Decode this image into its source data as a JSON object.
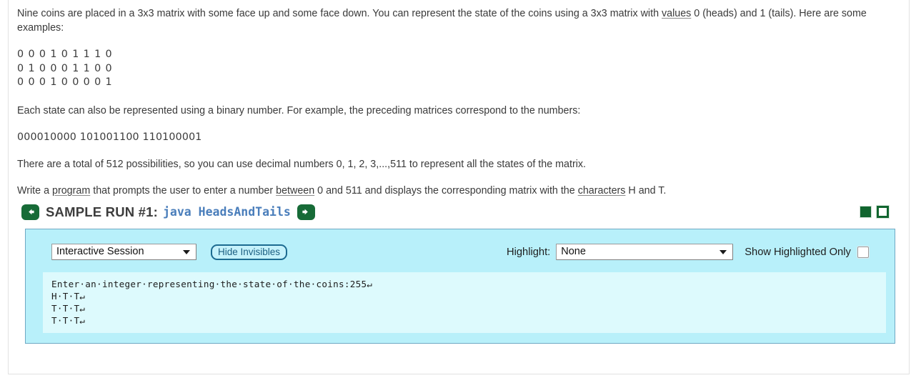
{
  "document": {
    "paragraphs": [
      "Nine coins are placed in a 3x3 matrix with some face up and some face down. You can represent the state of the coins using a 3x3 matrix with ",
      " 0 (heads) and 1 (tails). Here are some examples:"
    ],
    "p1_underlined_word": "values",
    "matrix_rows": [
      "0 0 0 1 0 1 1 1 0",
      "0 1 0 0 0 1 1 0 0",
      "0 0 0 1 0 0 0 0 1"
    ],
    "p2": "Each state can also be represented using a binary number. For example, the preceding matrices correspond to the numbers:",
    "binary_line": "000010000 101001100 110100001",
    "p3": "There are a total of 512 possibilities, so you can use decimal numbers 0, 1, 2, 3,...,511 to represent all the states of the matrix.",
    "p4_parts": {
      "a": "Write a ",
      "u1": "program",
      "b": " that prompts the user to enter a number ",
      "u2": "between",
      "c": " 0 and 511 and displays the corresponding matrix with the ",
      "u3": "characters",
      "d": " H and T."
    }
  },
  "sample_run": {
    "prev_icon": "arrow-left-icon",
    "next_icon": "arrow-right-icon",
    "title": "SAMPLE RUN #1:",
    "command": "java HeadsAndTails",
    "indicator_filled": "filled-square-indicator",
    "indicator_open": "open-square-indicator"
  },
  "panel": {
    "session_select": {
      "value": "Interactive Session",
      "options": [
        "Interactive Session"
      ]
    },
    "hide_invisibles_label": "Hide Invisibles",
    "highlight_label": "Highlight:",
    "highlight_select": {
      "value": "None",
      "options": [
        "None"
      ]
    },
    "show_highlighted_only_label": "Show Highlighted Only",
    "show_highlighted_only_checked": false,
    "terminal_lines": [
      "Enter·an·integer·representing·the·state·of·the·coins:255↵",
      "H·T·T↵",
      "T·T·T↵",
      "T·T·T↵"
    ]
  },
  "colors": {
    "panel_background": "#b8f0fa",
    "terminal_background": "#ddfafd",
    "accent_green": "#176b37",
    "command_blue": "#4a7ebb",
    "button_teal": "#1c6b91"
  }
}
